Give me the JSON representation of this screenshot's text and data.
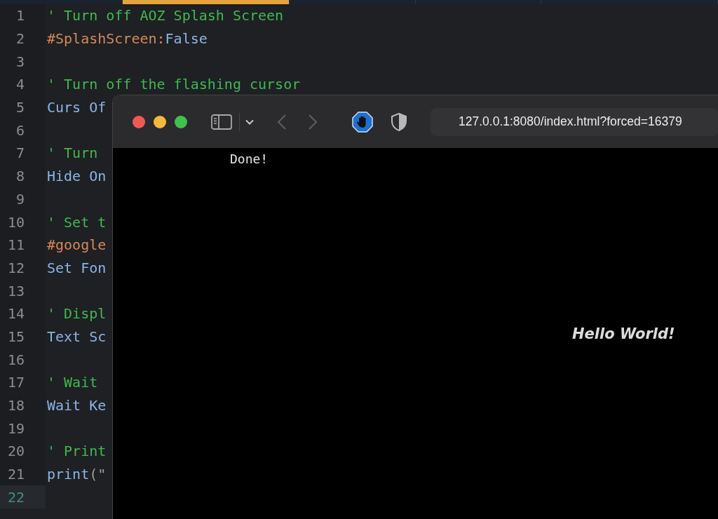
{
  "editor": {
    "tabs": [
      {
        "selected": false
      },
      {
        "selected": true
      },
      {
        "selected": false
      },
      {
        "selected": false
      },
      {
        "selected": false
      }
    ],
    "lines": [
      {
        "number": "1",
        "current": false,
        "tokens": [
          {
            "kind": "comment",
            "text": "' Turn off AOZ Splash Screen"
          }
        ]
      },
      {
        "number": "2",
        "current": false,
        "tokens": [
          {
            "kind": "directive",
            "text": "#SplashScreen:"
          },
          {
            "kind": "keyword",
            "text": "False"
          }
        ]
      },
      {
        "number": "3",
        "current": false
      },
      {
        "number": "4",
        "current": false,
        "tokens": [
          {
            "kind": "comment",
            "text": "' Turn off the flashing cursor"
          }
        ]
      },
      {
        "number": "5",
        "current": false,
        "tokens": [
          {
            "kind": "keyword",
            "text": "Curs Of"
          }
        ]
      },
      {
        "number": "6",
        "current": false
      },
      {
        "number": "7",
        "current": false,
        "tokens": [
          {
            "kind": "comment",
            "text": "' Turn"
          }
        ]
      },
      {
        "number": "8",
        "current": false,
        "tokens": [
          {
            "kind": "keyword",
            "text": "Hide On"
          }
        ]
      },
      {
        "number": "9",
        "current": false
      },
      {
        "number": "10",
        "current": false,
        "tokens": [
          {
            "kind": "comment",
            "text": "' Set t"
          }
        ]
      },
      {
        "number": "11",
        "current": false,
        "tokens": [
          {
            "kind": "directive",
            "text": "#google"
          }
        ]
      },
      {
        "number": "12",
        "current": false,
        "tokens": [
          {
            "kind": "keyword",
            "text": "Set Fon"
          }
        ]
      },
      {
        "number": "13",
        "current": false
      },
      {
        "number": "14",
        "current": false,
        "tokens": [
          {
            "kind": "comment",
            "text": "' Displ"
          }
        ]
      },
      {
        "number": "15",
        "current": false,
        "tokens": [
          {
            "kind": "keyword",
            "text": "Text Sc"
          }
        ]
      },
      {
        "number": "16",
        "current": false
      },
      {
        "number": "17",
        "current": false,
        "tokens": [
          {
            "kind": "comment",
            "text": "' Wait"
          }
        ]
      },
      {
        "number": "18",
        "current": false,
        "tokens": [
          {
            "kind": "keyword",
            "text": "Wait Ke"
          }
        ]
      },
      {
        "number": "19",
        "current": false
      },
      {
        "number": "20",
        "current": false,
        "tokens": [
          {
            "kind": "comment",
            "text": "' Print"
          }
        ]
      },
      {
        "number": "21",
        "current": false,
        "tokens": [
          {
            "kind": "keyword",
            "text": "print"
          },
          {
            "kind": "punct",
            "text": "(\""
          }
        ]
      },
      {
        "number": "22",
        "current": true
      }
    ]
  },
  "browser": {
    "back": {
      "disabled": true
    },
    "forward": {
      "disabled": true
    },
    "url": "127.0.0.1:8080/index.html?forced=16379",
    "output": {
      "printed_text": "Done!",
      "styled_text": "Hello World!"
    }
  }
}
